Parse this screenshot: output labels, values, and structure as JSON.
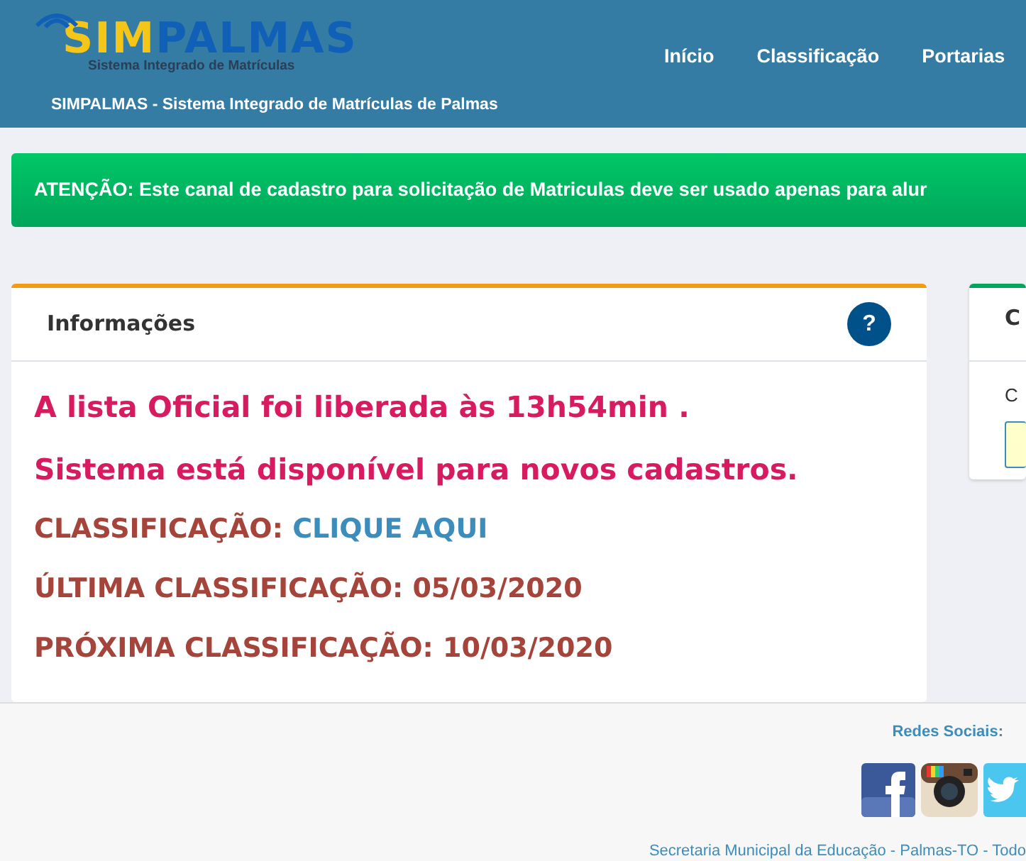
{
  "header": {
    "logo": {
      "lead": "SIM",
      "rest": "PALMAS",
      "tagline": "Sistema Integrado de Matrículas"
    },
    "subtitle": "SIMPALMAS - Sistema Integrado de Matrículas de Palmas",
    "nav": [
      "Início",
      "Classificação",
      "Portarias"
    ]
  },
  "alert": "ATENÇÃO: Este canal de cadastro para solicitação de Matriculas deve ser usado apenas para alur",
  "info_card": {
    "title": "Informações",
    "help": "?",
    "lines": [
      {
        "kind": "notice",
        "text": "A lista Oficial foi liberada às 13h54min ."
      },
      {
        "kind": "notice",
        "text": "Sistema está disponível para novos cadastros."
      },
      {
        "kind": "link",
        "text": "CLASSIFICAÇÃO: ",
        "link": "CLIQUE AQUI"
      },
      {
        "kind": "plain",
        "text": "ÚLTIMA CLASSIFICAÇÃO: 05/03/2020"
      },
      {
        "kind": "plain",
        "text": "PRÓXIMA CLASSIFICAÇÃO: 10/03/2020"
      }
    ]
  },
  "side_card": {
    "title": "C",
    "label": "C"
  },
  "footer": {
    "social_title": "Redes Sociais:",
    "social": [
      {
        "kind": "facebook"
      },
      {
        "kind": "instagram"
      },
      {
        "kind": "twitter"
      }
    ],
    "credit": "Secretaria Municipal da Educação - Palmas-TO - Todo"
  }
}
